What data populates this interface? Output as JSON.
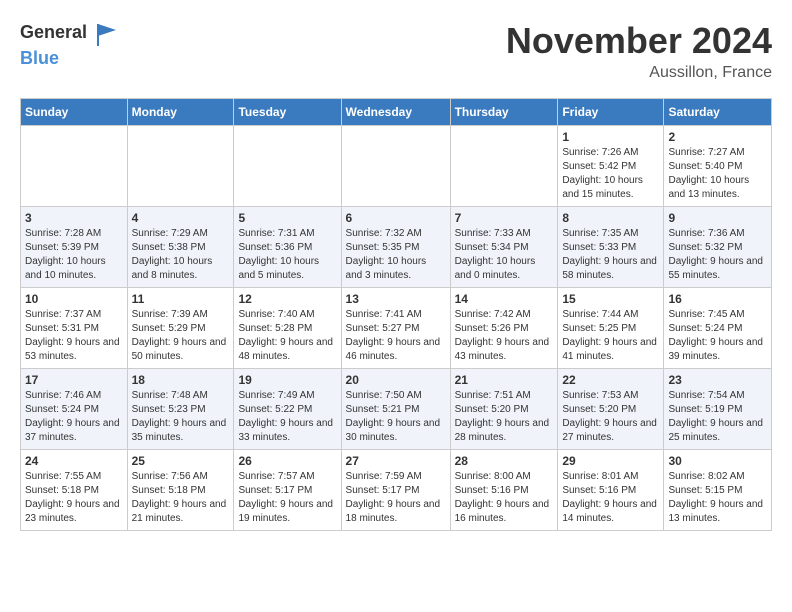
{
  "header": {
    "logo_general": "General",
    "logo_blue": "Blue",
    "month_title": "November 2024",
    "location": "Aussillon, France"
  },
  "columns": [
    "Sunday",
    "Monday",
    "Tuesday",
    "Wednesday",
    "Thursday",
    "Friday",
    "Saturday"
  ],
  "weeks": [
    [
      {
        "day": "",
        "info": ""
      },
      {
        "day": "",
        "info": ""
      },
      {
        "day": "",
        "info": ""
      },
      {
        "day": "",
        "info": ""
      },
      {
        "day": "",
        "info": ""
      },
      {
        "day": "1",
        "info": "Sunrise: 7:26 AM\nSunset: 5:42 PM\nDaylight: 10 hours and 15 minutes."
      },
      {
        "day": "2",
        "info": "Sunrise: 7:27 AM\nSunset: 5:40 PM\nDaylight: 10 hours and 13 minutes."
      }
    ],
    [
      {
        "day": "3",
        "info": "Sunrise: 7:28 AM\nSunset: 5:39 PM\nDaylight: 10 hours and 10 minutes."
      },
      {
        "day": "4",
        "info": "Sunrise: 7:29 AM\nSunset: 5:38 PM\nDaylight: 10 hours and 8 minutes."
      },
      {
        "day": "5",
        "info": "Sunrise: 7:31 AM\nSunset: 5:36 PM\nDaylight: 10 hours and 5 minutes."
      },
      {
        "day": "6",
        "info": "Sunrise: 7:32 AM\nSunset: 5:35 PM\nDaylight: 10 hours and 3 minutes."
      },
      {
        "day": "7",
        "info": "Sunrise: 7:33 AM\nSunset: 5:34 PM\nDaylight: 10 hours and 0 minutes."
      },
      {
        "day": "8",
        "info": "Sunrise: 7:35 AM\nSunset: 5:33 PM\nDaylight: 9 hours and 58 minutes."
      },
      {
        "day": "9",
        "info": "Sunrise: 7:36 AM\nSunset: 5:32 PM\nDaylight: 9 hours and 55 minutes."
      }
    ],
    [
      {
        "day": "10",
        "info": "Sunrise: 7:37 AM\nSunset: 5:31 PM\nDaylight: 9 hours and 53 minutes."
      },
      {
        "day": "11",
        "info": "Sunrise: 7:39 AM\nSunset: 5:29 PM\nDaylight: 9 hours and 50 minutes."
      },
      {
        "day": "12",
        "info": "Sunrise: 7:40 AM\nSunset: 5:28 PM\nDaylight: 9 hours and 48 minutes."
      },
      {
        "day": "13",
        "info": "Sunrise: 7:41 AM\nSunset: 5:27 PM\nDaylight: 9 hours and 46 minutes."
      },
      {
        "day": "14",
        "info": "Sunrise: 7:42 AM\nSunset: 5:26 PM\nDaylight: 9 hours and 43 minutes."
      },
      {
        "day": "15",
        "info": "Sunrise: 7:44 AM\nSunset: 5:25 PM\nDaylight: 9 hours and 41 minutes."
      },
      {
        "day": "16",
        "info": "Sunrise: 7:45 AM\nSunset: 5:24 PM\nDaylight: 9 hours and 39 minutes."
      }
    ],
    [
      {
        "day": "17",
        "info": "Sunrise: 7:46 AM\nSunset: 5:24 PM\nDaylight: 9 hours and 37 minutes."
      },
      {
        "day": "18",
        "info": "Sunrise: 7:48 AM\nSunset: 5:23 PM\nDaylight: 9 hours and 35 minutes."
      },
      {
        "day": "19",
        "info": "Sunrise: 7:49 AM\nSunset: 5:22 PM\nDaylight: 9 hours and 33 minutes."
      },
      {
        "day": "20",
        "info": "Sunrise: 7:50 AM\nSunset: 5:21 PM\nDaylight: 9 hours and 30 minutes."
      },
      {
        "day": "21",
        "info": "Sunrise: 7:51 AM\nSunset: 5:20 PM\nDaylight: 9 hours and 28 minutes."
      },
      {
        "day": "22",
        "info": "Sunrise: 7:53 AM\nSunset: 5:20 PM\nDaylight: 9 hours and 27 minutes."
      },
      {
        "day": "23",
        "info": "Sunrise: 7:54 AM\nSunset: 5:19 PM\nDaylight: 9 hours and 25 minutes."
      }
    ],
    [
      {
        "day": "24",
        "info": "Sunrise: 7:55 AM\nSunset: 5:18 PM\nDaylight: 9 hours and 23 minutes."
      },
      {
        "day": "25",
        "info": "Sunrise: 7:56 AM\nSunset: 5:18 PM\nDaylight: 9 hours and 21 minutes."
      },
      {
        "day": "26",
        "info": "Sunrise: 7:57 AM\nSunset: 5:17 PM\nDaylight: 9 hours and 19 minutes."
      },
      {
        "day": "27",
        "info": "Sunrise: 7:59 AM\nSunset: 5:17 PM\nDaylight: 9 hours and 18 minutes."
      },
      {
        "day": "28",
        "info": "Sunrise: 8:00 AM\nSunset: 5:16 PM\nDaylight: 9 hours and 16 minutes."
      },
      {
        "day": "29",
        "info": "Sunrise: 8:01 AM\nSunset: 5:16 PM\nDaylight: 9 hours and 14 minutes."
      },
      {
        "day": "30",
        "info": "Sunrise: 8:02 AM\nSunset: 5:15 PM\nDaylight: 9 hours and 13 minutes."
      }
    ]
  ]
}
